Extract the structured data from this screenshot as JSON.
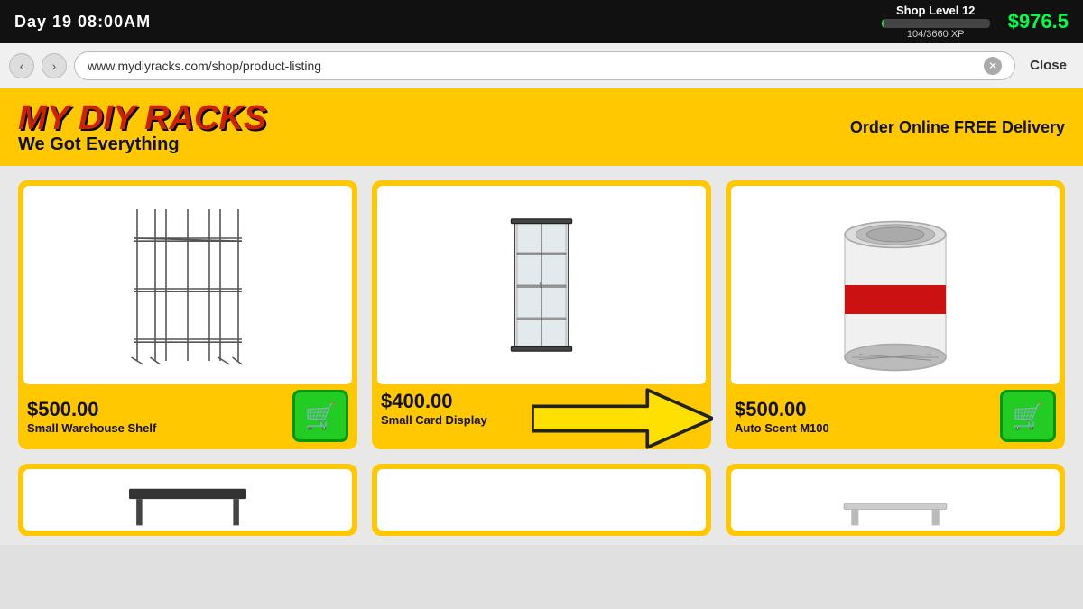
{
  "topbar": {
    "day_time": "Day 19   08:00AM",
    "shop_level": "Shop Level 12",
    "xp_current": 104,
    "xp_max": 3660,
    "xp_label": "104/3660 XP",
    "xp_percent": 2.8,
    "cash": "$976.5"
  },
  "browser": {
    "url": "www.mydiyracks.com/shop/product-listing",
    "close_label": "Close"
  },
  "shop": {
    "name": "MY DIY RACKS",
    "slogan": "We Got Everything",
    "promo": "Order Online FREE Delivery"
  },
  "products": [
    {
      "id": "small-warehouse-shelf",
      "price": "$500.00",
      "name": "Small Warehouse Shelf",
      "type": "shelf"
    },
    {
      "id": "small-card-display",
      "price": "$400.00",
      "name": "Small Card Display",
      "type": "display"
    },
    {
      "id": "auto-scent-m100",
      "price": "$500.00",
      "name": "Auto Scent M100",
      "type": "scent"
    }
  ],
  "bottom_products": [
    {
      "id": "bottom-1",
      "type": "shelf2"
    },
    {
      "id": "bottom-2",
      "type": "empty"
    },
    {
      "id": "bottom-3",
      "type": "flat"
    }
  ],
  "cart_icon": "🛒"
}
